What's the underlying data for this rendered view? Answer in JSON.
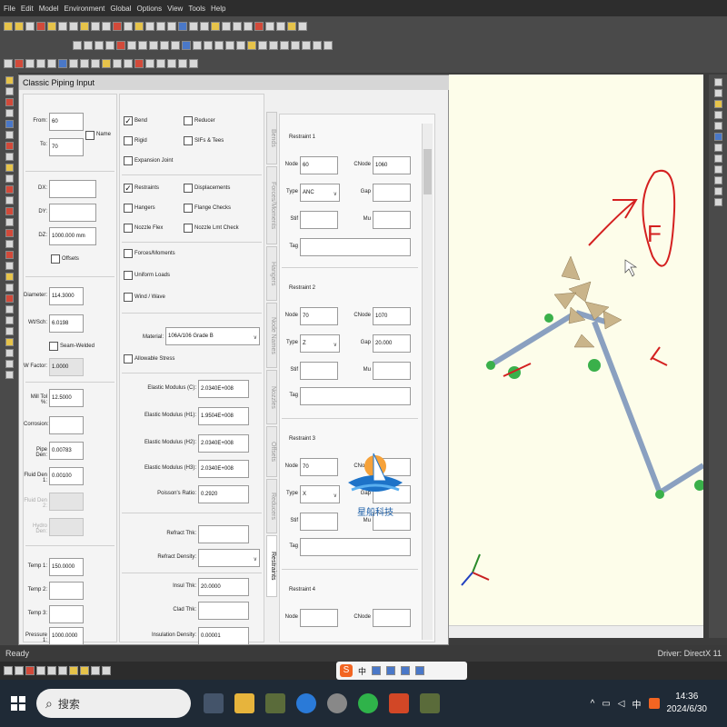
{
  "menu": [
    "File",
    "Edit",
    "Model",
    "Environment",
    "Global",
    "Options",
    "View",
    "Tools",
    "Help"
  ],
  "panel": {
    "title": "Classic Piping Input",
    "from_label": "From:",
    "from_value": "60",
    "to_label": "To:",
    "to_value": "70",
    "name_label": "Name",
    "dx_label": "DX:",
    "dy_label": "DY:",
    "dz_label": "DZ:",
    "dx_value": "",
    "dy_value": "",
    "dz_value": "1000.000 mm",
    "offsets_label": "Offsets",
    "diameter_label": "Diameter:",
    "diameter_value": "114.3000",
    "wtsch_label": "Wt/Sch:",
    "wtsch_value": "6.0198",
    "seam_welded_label": "Seam-Welded",
    "wfactor_label": "W Factor:",
    "wfactor_value": "1.0000",
    "mill_tol_label": "Mill Tol %:",
    "mill_tol_value": "12.5000",
    "corrosion_label": "Corrosion:",
    "corrosion_value": "",
    "pipe_den_label": "Pipe Den:",
    "pipe_den_value": "0.00783",
    "fluid_den1_label": "Fluid Den 1:",
    "fluid_den1_value": "0.00100",
    "fluid_den2_label": "Fluid Den 2:",
    "hydro_den_label": "Hydro Den:",
    "temp1_label": "Temp 1:",
    "temp1_value": "150.0000",
    "temp2_label": "Temp 2:",
    "temp3_label": "Temp 3:",
    "pressure1_label": "Pressure 1:",
    "pressure1_value": "1000.0000",
    "options": {
      "bend": "Bend",
      "reducer": "Reducer",
      "rigid": "Rigid",
      "sifs_tees": "SIFs & Tees",
      "expansion_joint": "Expansion Joint",
      "restraints": "Restraints",
      "displacements": "Displacements",
      "hangers": "Hangers",
      "flange_checks": "Flange Checks",
      "nozzle_flex": "Nozzle Flex",
      "nozzle_lmt_check": "Nozzle Lmt Check",
      "forces_moments": "Forces/Moments",
      "uniform_loads": "Uniform Loads",
      "wind_wave": "Wind / Wave"
    },
    "material_label": "Material:",
    "material_value": "106A/106 Grade B",
    "allowable_stress_label": "Allowable Stress",
    "elastic_c_label": "Elastic Modulus (C):",
    "elastic_c_value": "2.0340E+008",
    "elastic_h1_label": "Elastic Modulus (H1):",
    "elastic_h1_value": "1.9504E+008",
    "elastic_h2_label": "Elastic Modulus (H2):",
    "elastic_h2_value": "2.0340E+008",
    "elastic_h3_label": "Elastic Modulus (H3):",
    "elastic_h3_value": "2.0340E+008",
    "poissons_label": "Poisson's Ratio:",
    "poissons_value": "0.2920",
    "refract_thk_label": "Refract Thk:",
    "refract_den_label": "Refract Density:",
    "insul_thk_label": "Insul Thk:",
    "insul_thk_value": "20.0000",
    "clad_thk_label": "Clad Thk:",
    "insul_den_label": "Insulation Density:",
    "insul_den_value": "0.00001",
    "vtabs": [
      "Bends",
      "Forces/Moments",
      "Hangers",
      "Node Names",
      "Nozzles",
      "Offsets",
      "Reducers",
      "Restraints"
    ],
    "restraints": [
      {
        "title": "Restraint 1",
        "node": "60",
        "cnode": "1060",
        "type": "ANC",
        "gap": "",
        "stif": "",
        "mu": "",
        "tag": ""
      },
      {
        "title": "Restraint 2",
        "node": "70",
        "cnode": "1070",
        "type": "Z",
        "gap": "20.000",
        "stif": "",
        "mu": "",
        "tag": ""
      },
      {
        "title": "Restraint 3",
        "node": "70",
        "cnode": "",
        "type": "X",
        "gap": "",
        "stif": "",
        "mu": "",
        "tag": ""
      },
      {
        "title": "Restraint 4",
        "node": "",
        "cnode": ""
      }
    ],
    "labels": {
      "node": "Node",
      "cnode": "CNode",
      "type": "Type",
      "gap": "Gap",
      "stif": "Stif",
      "mu": "Mu",
      "tag": "Tag"
    }
  },
  "view3d": {
    "annotation_letter": "F"
  },
  "watermark": {
    "text": "星船科技"
  },
  "status": {
    "left": "Ready",
    "right": "Driver: DirectX 11"
  },
  "taskbar": {
    "search_placeholder": "搜索",
    "time": "14:36",
    "date": "2024/6/30",
    "ime": "中"
  }
}
